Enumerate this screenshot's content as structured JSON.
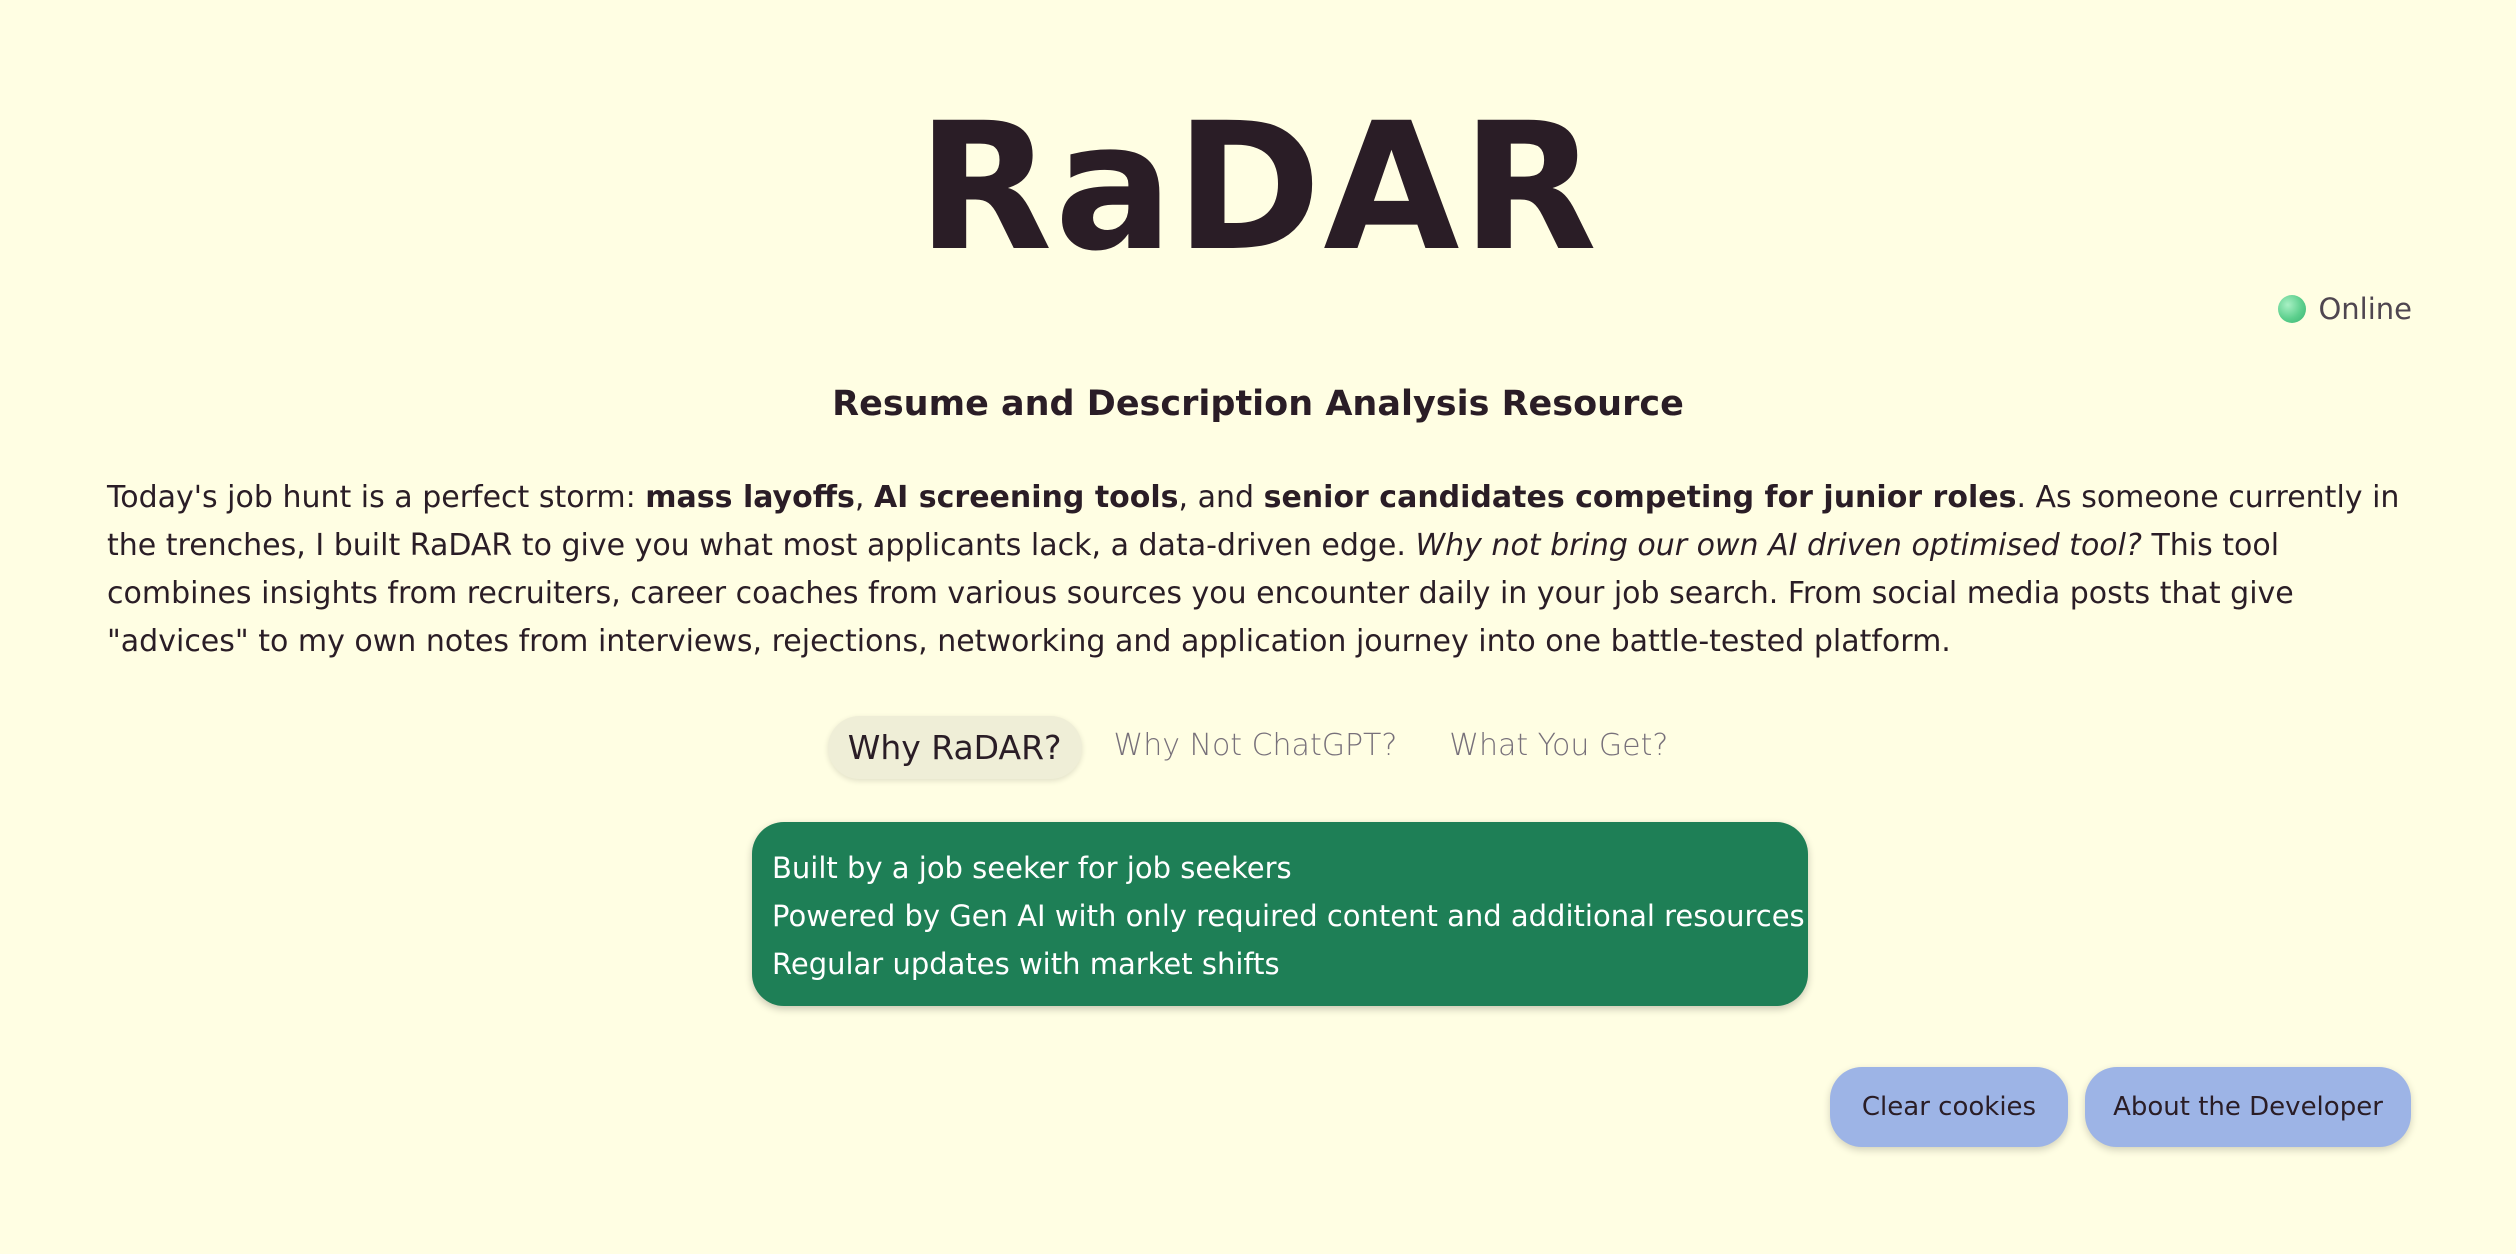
{
  "logo": "RaDAR",
  "status": {
    "label": "Online",
    "color": "#5ccf8d"
  },
  "subtitle": "Resume and Description Analysis Resource",
  "intro": {
    "t1": "Today's job hunt is a perfect storm: ",
    "b1": "mass layoffs",
    "t2": ", ",
    "b2": "AI screening tools",
    "t3": ", and ",
    "b3": "senior candidates competing for junior roles",
    "t4": ". As someone currently in the trenches, I built RaDAR to give you what most applicants lack, a data-driven edge. ",
    "i1": "Why not bring our own AI driven optimised tool?",
    "t5": " This tool combines insights from recruiters, career coaches from various sources you encounter daily in your job search. From social media posts that give \"advices\" to my own notes from interviews, rejections, networking and application journey into one battle-tested platform."
  },
  "tabs": [
    {
      "label": "Why RaDAR?",
      "active": true
    },
    {
      "label": "Why Not ChatGPT?",
      "active": false
    },
    {
      "label": "What You Get?",
      "active": false
    }
  ],
  "card": {
    "color": "#1e7f56",
    "items": [
      "Built by a job seeker for job seekers",
      "Powered by Gen AI with only required content and additional resources",
      "Regular updates with market shifts"
    ]
  },
  "buttons": {
    "clear_cookies": "Clear cookies",
    "about_developer": "About the Developer",
    "color": "#9db4e6"
  }
}
